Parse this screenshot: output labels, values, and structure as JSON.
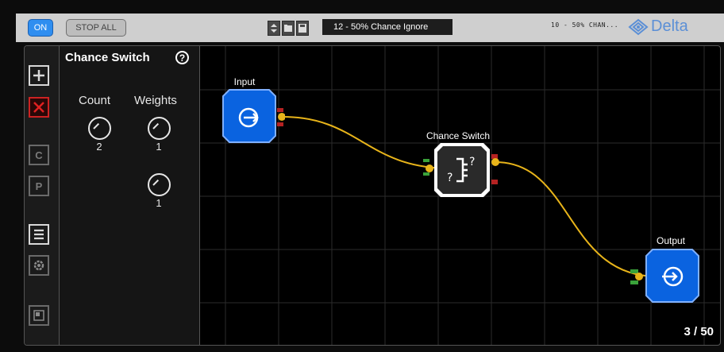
{
  "topbar": {
    "on_label": "ON",
    "stop_all_label": "STOP ALL",
    "preset_name": "12 - 50% Chance Ignore",
    "note": "10 - 50% CHAN...",
    "logo_text": "Delta"
  },
  "inspector": {
    "title": "Chance Switch",
    "count_label": "Count",
    "weights_label": "Weights",
    "count_value": "2",
    "weight_1": "1",
    "weight_2": "1"
  },
  "toolbar": {
    "c_label": "C",
    "p_label": "P"
  },
  "graph": {
    "input_label": "Input",
    "switch_label": "Chance Switch",
    "output_label": "Output",
    "counter": "3 / 50"
  },
  "colors": {
    "node_blue": "#0a63e0",
    "wire": "#e8b41a",
    "port_green": "#3aa23a",
    "port_red": "#b52222"
  }
}
